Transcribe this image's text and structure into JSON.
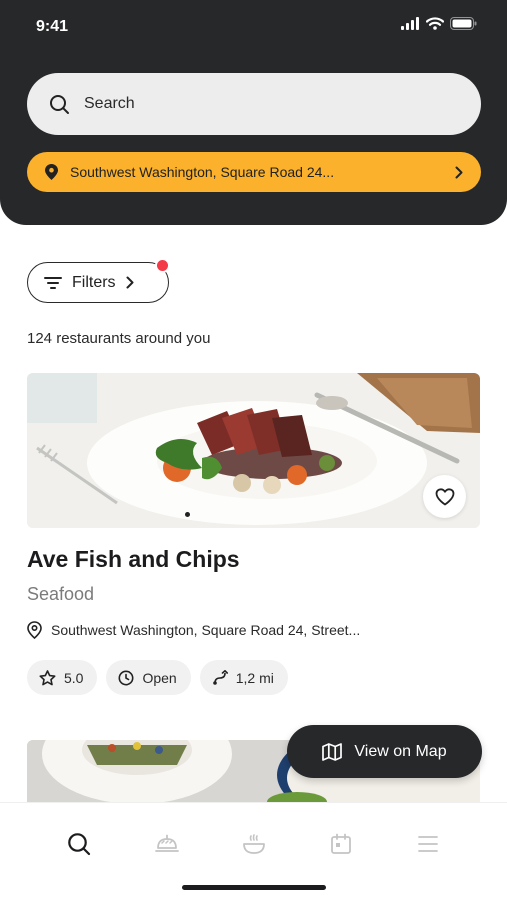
{
  "status_bar": {
    "time": "9:41"
  },
  "search": {
    "placeholder": "Search"
  },
  "location": {
    "text": "Southwest Washington, Square Road 24..."
  },
  "filters": {
    "label": "Filters"
  },
  "results": {
    "count_text": "124 restaurants around you"
  },
  "restaurants": [
    {
      "name": "Ave Fish and Chips",
      "cuisine": "Seafood",
      "address": "Southwest Washington, Square Road 24, Street...",
      "rating": "5.0",
      "status": "Open",
      "distance": "1,2 mi"
    }
  ],
  "map_button": {
    "label": "View on Map"
  },
  "tabbar": {
    "icons": [
      "search-icon",
      "service-bell-icon",
      "bowl-icon",
      "calendar-icon",
      "menu-icon"
    ]
  },
  "colors": {
    "header_bg": "#26282a",
    "accent": "#fbb12b",
    "badge": "#f23a48"
  }
}
